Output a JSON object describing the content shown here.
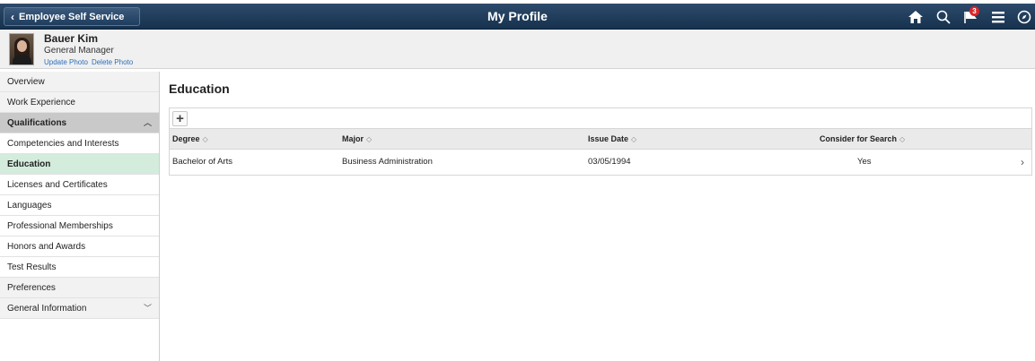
{
  "header": {
    "back_label": "Employee Self Service",
    "title": "My Profile",
    "notification_count": "3",
    "icons": [
      "home-icon",
      "search-icon",
      "notifications-icon",
      "menu-icon",
      "navigator-icon"
    ]
  },
  "profile": {
    "name": "Bauer Kim",
    "role": "General Manager",
    "update_photo": "Update Photo",
    "delete_photo": "Delete Photo"
  },
  "sidebar": {
    "items": [
      {
        "label": "Overview"
      },
      {
        "label": "Work Experience"
      },
      {
        "label": "Qualifications"
      },
      {
        "label": "Competencies and Interests"
      },
      {
        "label": "Education"
      },
      {
        "label": "Licenses and Certificates"
      },
      {
        "label": "Languages"
      },
      {
        "label": "Professional Memberships"
      },
      {
        "label": "Honors and Awards"
      },
      {
        "label": "Test Results"
      },
      {
        "label": "Preferences"
      },
      {
        "label": "General Information"
      }
    ]
  },
  "main": {
    "heading": "Education",
    "add_label": "+",
    "columns": [
      "Degree",
      "Major",
      "Issue Date",
      "Consider for Search"
    ],
    "rows": [
      {
        "degree": "Bachelor of Arts",
        "major": "Business Administration",
        "issue_date": "03/05/1994",
        "consider": "Yes"
      }
    ]
  },
  "colors": {
    "header_bg": "#1f3d5e",
    "active_item": "#d3ecdc",
    "link": "#2a6ebb",
    "badge": "#d8262c"
  }
}
